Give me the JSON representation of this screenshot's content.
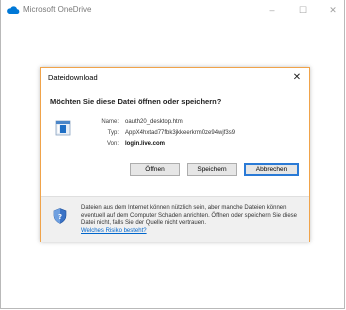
{
  "window": {
    "title": "Microsoft OneDrive",
    "controls": {
      "minimize": "–",
      "maximize": "☐",
      "close": "✕"
    }
  },
  "dialog": {
    "title": "Dateidownload",
    "close_glyph": "✕",
    "question": "Möchten Sie diese Datei öffnen oder speichern?",
    "file": {
      "name_label": "Name:",
      "name_value": "oauth20_desktop.htm",
      "type_label": "Typ:",
      "type_value": "AppX4hxtad77fbk3jkkeerkrm0ze94wjf3s9",
      "from_label": "Von:",
      "from_value": "login.live.com"
    },
    "buttons": {
      "open": "Öffnen",
      "save": "Speichern",
      "cancel": "Abbrechen"
    },
    "warning": {
      "text": "Dateien aus dem Internet können nützlich sein, aber manche Dateien können eventuell auf dem Computer Schaden anrichten. Öffnen oder speichern Sie diese Datei nicht, falls Sie der Quelle nicht vertrauen.",
      "link": "Welches Risiko besteht?"
    }
  },
  "colors": {
    "dialog_border": "#f0a34a",
    "onedrive_icon": "#0078d7",
    "link": "#0066cc"
  },
  "icons": [
    "onedrive-cloud-icon",
    "file-htm-icon",
    "security-shield-icon"
  ]
}
